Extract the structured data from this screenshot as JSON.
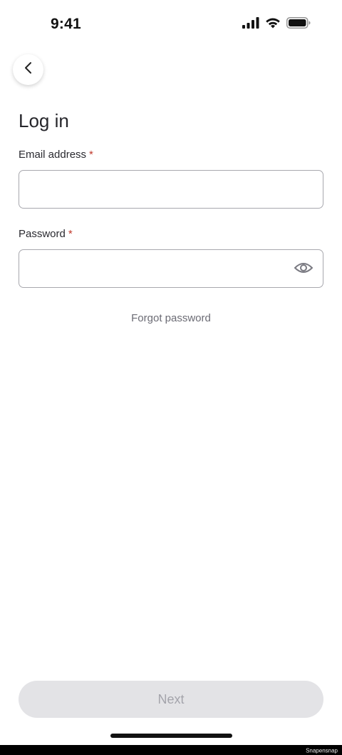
{
  "status_bar": {
    "time": "9:41",
    "icons": [
      "cellular-signal-icon",
      "wifi-icon",
      "battery-icon"
    ]
  },
  "header": {
    "back_icon": "chevron-left-icon",
    "title": "Log in"
  },
  "form": {
    "email": {
      "label": "Email address",
      "required_mark": "*",
      "value": "",
      "placeholder": ""
    },
    "password": {
      "label": "Password",
      "required_mark": "*",
      "value": "",
      "placeholder": "",
      "toggle_icon": "eye-icon"
    },
    "forgot_password": "Forgot password"
  },
  "footer": {
    "next_label": "Next",
    "next_enabled": false,
    "watermark": "Snapensnap"
  },
  "colors": {
    "required": "#c0392b",
    "disabled_button_bg": "#e3e3e6",
    "disabled_button_text": "#a4a4ab",
    "link": "#6b6b74",
    "input_border": "#a8a8ae"
  }
}
